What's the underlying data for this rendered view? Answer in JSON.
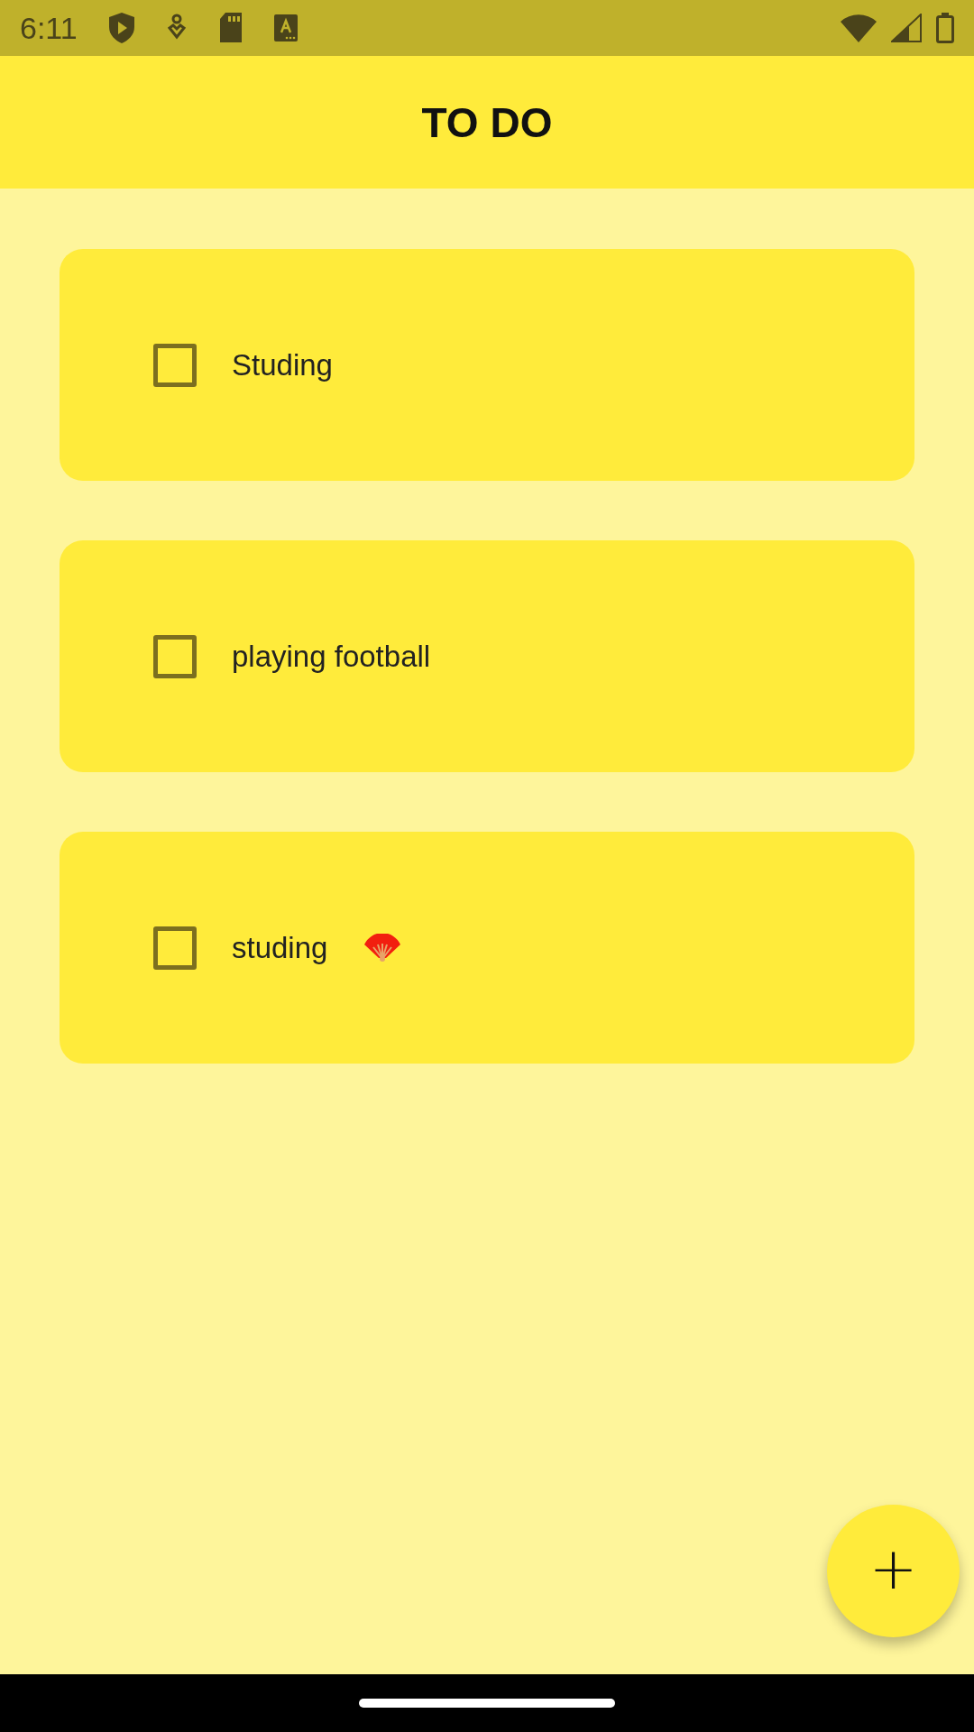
{
  "status_bar": {
    "time": "6:11"
  },
  "app_bar": {
    "title": "TO DO"
  },
  "tasks": [
    {
      "text": "Studing",
      "checked": false,
      "kind": "plain"
    },
    {
      "text": "playing football",
      "checked": false,
      "kind": "plain"
    },
    {
      "text": "studing",
      "checked": false,
      "kind": "with_icon"
    }
  ],
  "fab": {
    "label": "+"
  }
}
